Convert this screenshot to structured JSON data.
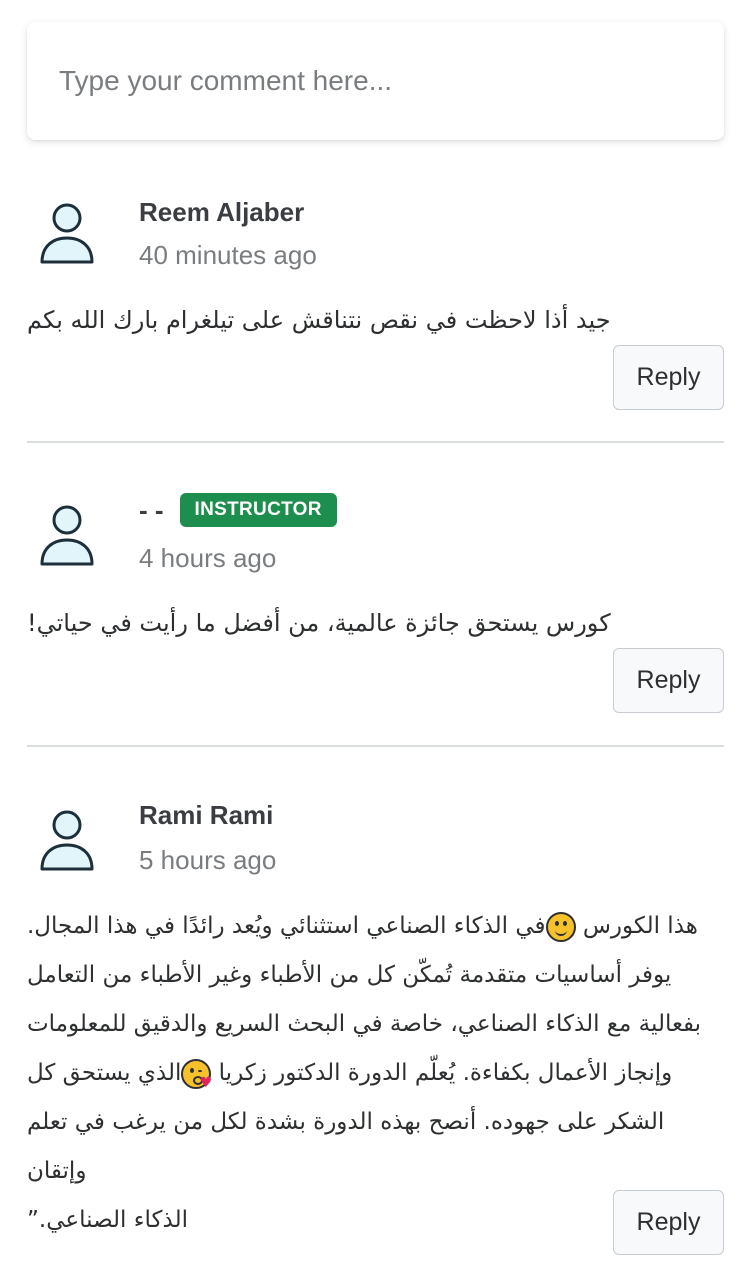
{
  "comment_input": {
    "placeholder": "Type your comment here..."
  },
  "reply_label": "Reply",
  "comments": [
    {
      "author": "Reem Aljaber",
      "time": "40 minutes ago",
      "text": "جيد أذا لاحظت في نقص نتناقش على تيلغرام بارك الله بكم"
    },
    {
      "author": "- -",
      "badge": "INSTRUCTOR",
      "time": "4 hours ago",
      "text": "كورس يستحق جائزة عالمية، من أفضل ما رأيت في حياتي!"
    },
    {
      "author": "Rami Rami",
      "time": "5 hours ago",
      "lines": [
        {
          "before": "هذا الكورس ",
          "emoji": "slightly-smiling-face-icon",
          "after": "في الذكاء الصناعي استثنائي ويُعد رائدًا في هذا المجال."
        },
        {
          "text": "يوفر أساسيات متقدمة تُمكّن كل من الأطباء وغير الأطباء من التعامل"
        },
        {
          "text": "بفعالية مع الذكاء الصناعي، خاصة في البحث السريع والدقيق للمعلومات"
        },
        {
          "before": "وإنجاز الأعمال بكفاءة. يُعلّم الدورة الدكتور زكريا ",
          "emoji": "face-blowing-kiss-icon",
          "after": "الذي يستحق كل"
        },
        {
          "text": "الشكر على جهوده. أنصح بهذه الدورة بشدة لكل من يرغب في تعلم وإتقان"
        },
        {
          "text": "الذكاء الصناعي.”"
        }
      ]
    }
  ]
}
